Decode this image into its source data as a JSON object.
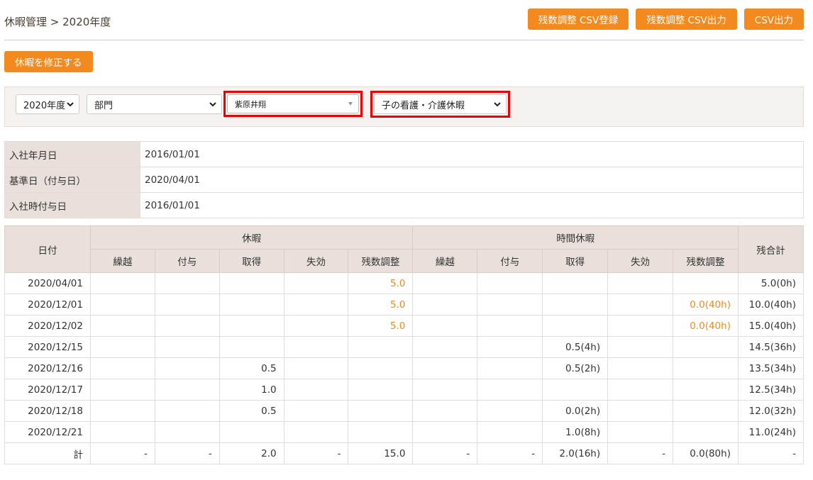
{
  "header": {
    "breadcrumb": "休暇管理 > 2020年度",
    "buttons": [
      "残数調整 CSV登録",
      "残数調整 CSV出力",
      "CSV出力"
    ]
  },
  "fix_button": "休暇を修正する",
  "filters": {
    "year": "2020年度",
    "department": "部門",
    "employee": "紫原井翔",
    "leave_type": "子の看護・介護休暇"
  },
  "info": [
    {
      "label": "入社年月日",
      "value": "2016/01/01"
    },
    {
      "label": "基準日（付与日）",
      "value": "2020/04/01"
    },
    {
      "label": "入社時付与日",
      "value": "2016/01/01"
    }
  ],
  "table": {
    "date_header": "日付",
    "group1": "休暇",
    "group2": "時間休暇",
    "total_header": "残合計",
    "sub_headers": [
      "繰越",
      "付与",
      "取得",
      "失効",
      "残数調整",
      "繰越",
      "付与",
      "取得",
      "失効",
      "残数調整"
    ],
    "rows": [
      [
        "2020/04/01",
        "",
        "",
        "",
        "",
        "5.0",
        "",
        "",
        "",
        "",
        "",
        "5.0(0h)"
      ],
      [
        "2020/12/01",
        "",
        "",
        "",
        "",
        "5.0",
        "",
        "",
        "",
        "",
        "0.0(40h)",
        "10.0(40h)"
      ],
      [
        "2020/12/02",
        "",
        "",
        "",
        "",
        "5.0",
        "",
        "",
        "",
        "",
        "0.0(40h)",
        "15.0(40h)"
      ],
      [
        "2020/12/15",
        "",
        "",
        "",
        "",
        "",
        "",
        "",
        "0.5(4h)",
        "",
        "",
        "14.5(36h)"
      ],
      [
        "2020/12/16",
        "",
        "",
        "0.5",
        "",
        "",
        "",
        "",
        "0.5(2h)",
        "",
        "",
        "13.5(34h)"
      ],
      [
        "2020/12/17",
        "",
        "",
        "1.0",
        "",
        "",
        "",
        "",
        "",
        "",
        "",
        "12.5(34h)"
      ],
      [
        "2020/12/18",
        "",
        "",
        "0.5",
        "",
        "",
        "",
        "",
        "0.0(2h)",
        "",
        "",
        "12.0(32h)"
      ],
      [
        "2020/12/21",
        "",
        "",
        "",
        "",
        "",
        "",
        "",
        "1.0(8h)",
        "",
        "",
        "11.0(24h)"
      ],
      [
        "計",
        "-",
        "-",
        "2.0",
        "-",
        "15.0",
        "-",
        "-",
        "2.0(16h)",
        "-",
        "0.0(80h)",
        "-"
      ]
    ]
  },
  "colors": {
    "accent": "#f28a1f",
    "header_bg": "#e9e0dc",
    "highlight": "#e00000"
  }
}
